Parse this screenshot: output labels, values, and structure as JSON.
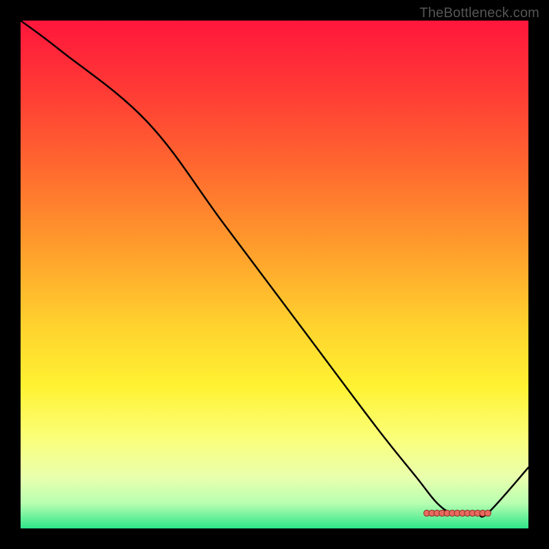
{
  "watermark": "TheBottleneck.com",
  "colors": {
    "border": "#000000",
    "curve": "#000000",
    "marker_fill": "#e86a5f",
    "marker_stroke": "#8a2d23",
    "gradient_stops": [
      {
        "offset": 0.0,
        "color": "#ff163c"
      },
      {
        "offset": 0.14,
        "color": "#ff3b35"
      },
      {
        "offset": 0.3,
        "color": "#ff6c2f"
      },
      {
        "offset": 0.45,
        "color": "#ff9e2c"
      },
      {
        "offset": 0.6,
        "color": "#ffd22e"
      },
      {
        "offset": 0.72,
        "color": "#fff232"
      },
      {
        "offset": 0.82,
        "color": "#fbff78"
      },
      {
        "offset": 0.9,
        "color": "#e8ffad"
      },
      {
        "offset": 0.95,
        "color": "#b9ffb1"
      },
      {
        "offset": 1.0,
        "color": "#2fe58a"
      }
    ]
  },
  "chart_data": {
    "type": "line",
    "title": "",
    "xlabel": "",
    "ylabel": "",
    "xlim": [
      0,
      100
    ],
    "ylim": [
      0,
      100
    ],
    "grid": false,
    "legend": false,
    "series": [
      {
        "name": "curve",
        "x": [
          0,
          8,
          25,
          40,
          55,
          70,
          78,
          82,
          85,
          88,
          90,
          92,
          100
        ],
        "y": [
          100,
          94,
          80,
          60,
          40,
          20,
          10,
          5,
          3,
          3,
          3,
          3,
          12
        ]
      }
    ],
    "markers": {
      "name": "bottom-cluster",
      "x": [
        80,
        81,
        82,
        83,
        84,
        85,
        86,
        87,
        88,
        89,
        90,
        91,
        92
      ],
      "y": [
        3,
        3,
        3,
        3,
        3,
        3,
        3,
        3,
        3,
        3,
        3,
        3,
        3
      ]
    }
  }
}
